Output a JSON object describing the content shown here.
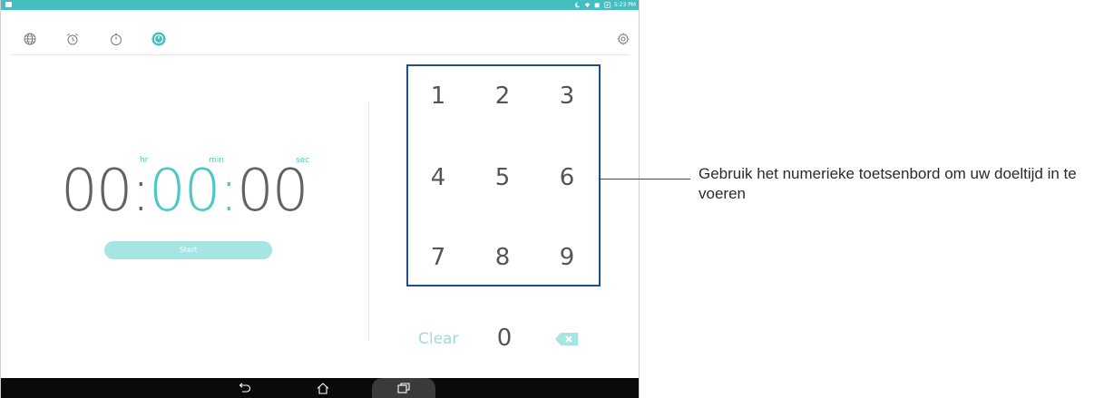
{
  "status_bar": {
    "time": "5:23 PM"
  },
  "tabs": [
    {
      "icon": "globe-icon"
    },
    {
      "icon": "alarm-icon"
    },
    {
      "icon": "stopwatch-icon"
    },
    {
      "icon": "timer-icon",
      "active": true
    }
  ],
  "settings_icon": "gear-icon",
  "timer": {
    "hr_label": "hr",
    "min_label": "min",
    "sec_label": "sec",
    "hours": "00",
    "minutes": "00",
    "seconds": "00",
    "sep1": ":",
    "sep2": ":",
    "start_label": "Start"
  },
  "keypad": {
    "keys": [
      "1",
      "2",
      "3",
      "4",
      "5",
      "6",
      "7",
      "8",
      "9"
    ],
    "clear_label": "Clear",
    "zero": "0",
    "backspace_icon": "backspace-icon"
  },
  "nav": {
    "back_icon": "back-icon",
    "home_icon": "home-icon",
    "recent_icon": "recent-apps-icon"
  },
  "callout": {
    "text": "Gebruik het numerieke toetsenbord om uw doeltijd in te voeren"
  },
  "colors": {
    "accent": "#43bfc1",
    "highlight_box": "#1f4f8e"
  }
}
